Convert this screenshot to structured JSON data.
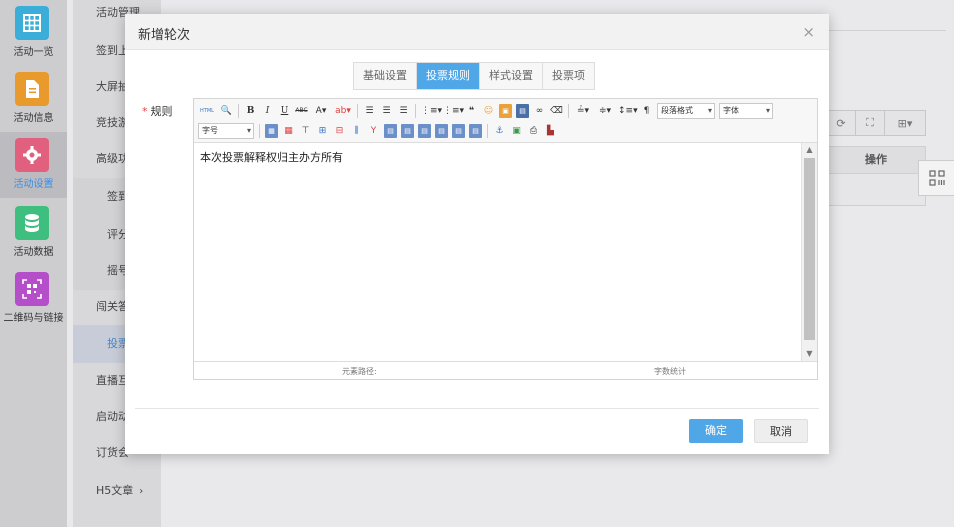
{
  "rail": {
    "items": [
      {
        "label": "活动一览",
        "icon": "grid-icon",
        "color": "#3aaed8"
      },
      {
        "label": "活动信息",
        "icon": "document-icon",
        "color": "#e99a2c"
      },
      {
        "label": "活动设置",
        "icon": "gear-icon",
        "color": "#e0607e"
      },
      {
        "label": "活动数据",
        "icon": "database-icon",
        "color": "#3fbf7f"
      },
      {
        "label": "二维码与链接",
        "icon": "qrcode-icon",
        "color": "#b44fc9"
      }
    ]
  },
  "submenu": {
    "items": [
      "活动管理",
      "签到上",
      "大屏抽",
      "竞技游",
      "高级功",
      "签到",
      "评分",
      "摇号",
      "闯关答",
      "投票",
      "直播互",
      "启动动",
      "订货会",
      "H5文章"
    ]
  },
  "background": {
    "operation_header": "操作"
  },
  "modal": {
    "title": "新增轮次",
    "close": "×",
    "tabs": [
      "基础设置",
      "投票规则",
      "样式设置",
      "投票项"
    ],
    "field_label": "规则",
    "required_mark": "*",
    "editor": {
      "content": "本次投票解释权归主办方所有",
      "para_format": "段落格式",
      "font_family": "字体",
      "font_size": "字号",
      "html_btn": "HTML",
      "status_path": "元素路径:",
      "status_count": "字数统计"
    },
    "confirm": "确定",
    "cancel": "取消"
  },
  "colors": {
    "primary": "#4fa7e8",
    "required": "#e64340"
  }
}
